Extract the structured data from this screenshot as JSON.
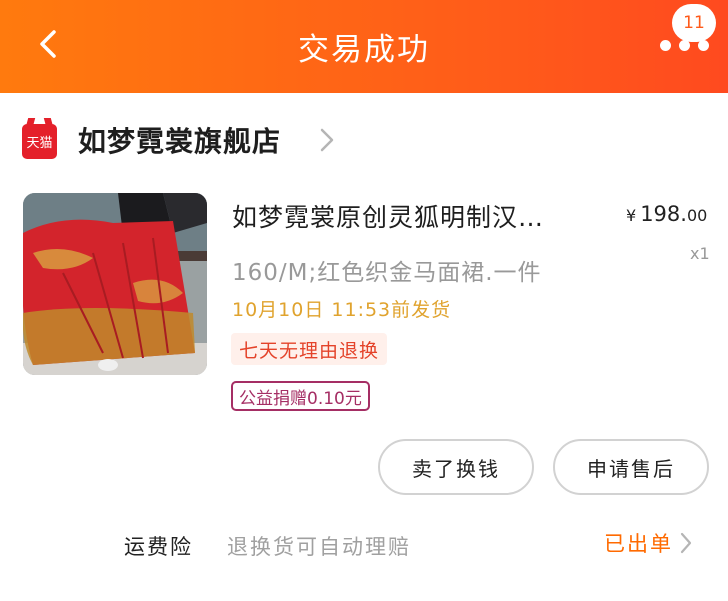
{
  "header": {
    "title": "交易成功",
    "badge_count": "11",
    "background": "#ff6a14"
  },
  "shop": {
    "platform_logo": "天猫",
    "name": "如梦霓裳旗舰店"
  },
  "product": {
    "title": "如梦霓裳原创灵狐明制汉…",
    "price_symbol": "¥",
    "price_int": "198.",
    "price_dec": "00",
    "quantity": "x1",
    "spec": "160/M;红色织金马面裙.一件",
    "ship_time": "10月10日 11:53前发货",
    "tag_return": "七天无理由退换",
    "tag_charity": "公益捐赠0.10元"
  },
  "actions": {
    "sell_label": "卖了换钱",
    "aftersale_label": "申请售后"
  },
  "insurance": {
    "label": "运费险",
    "description": "退换货可自动理赔",
    "status": "已出单"
  },
  "colors": {
    "accent": "#ff6a00",
    "ship_time": "#e0a32e",
    "return_tag": "#e4432a",
    "charity_tag": "#a52e64",
    "tmall_red": "#e4202a"
  }
}
